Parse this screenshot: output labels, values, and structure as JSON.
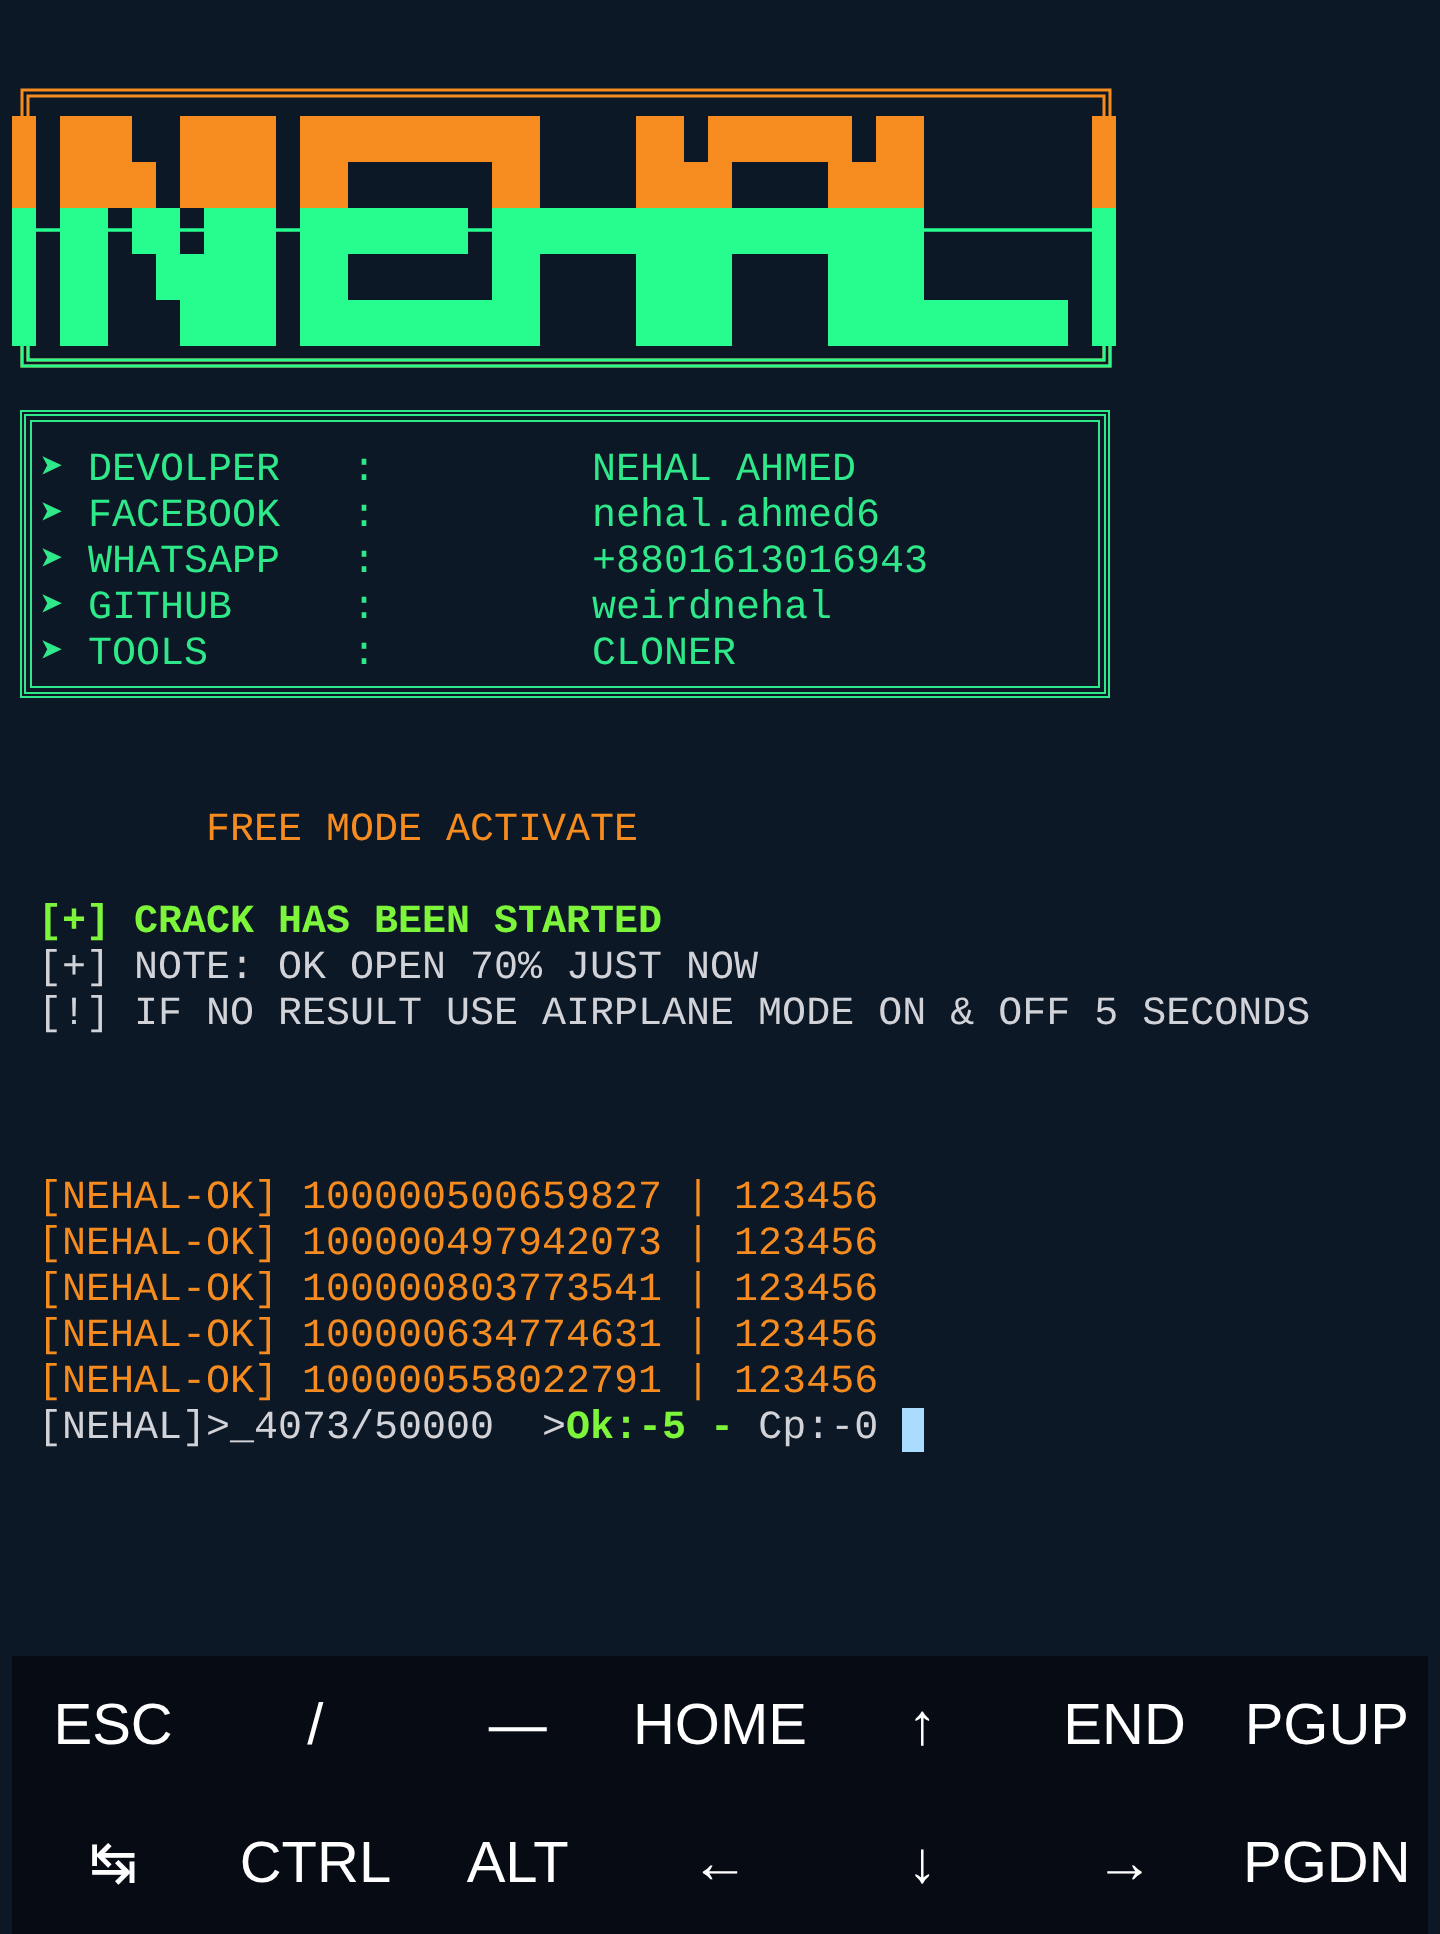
{
  "info": [
    {
      "bullet": "➤",
      "label": "DEVOLPER",
      "colon": ":",
      "value": "NEHAL AHMED"
    },
    {
      "bullet": "➤",
      "label": "FACEBOOK",
      "colon": ":",
      "value": "nehal.ahmed6"
    },
    {
      "bullet": "➤",
      "label": "WHATSAPP",
      "colon": ":",
      "value": "+8801613016943"
    },
    {
      "bullet": "➤",
      "label": "GITHUB",
      "colon": ":",
      "value": "weirdnehal"
    },
    {
      "bullet": "➤",
      "label": "TOOLS",
      "colon": ":",
      "value": "CLONER"
    }
  ],
  "mode": "FREE MODE ACTIVATE",
  "messages": [
    {
      "kind": "success",
      "text": "[+] CRACK HAS BEEN STARTED"
    },
    {
      "kind": "note",
      "text": "[+] NOTE: OK OPEN 70% JUST NOW"
    },
    {
      "kind": "note",
      "text": "[!] IF NO RESULT USE AIRPLANE MODE ON & OFF 5 SECONDS"
    }
  ],
  "results": [
    "[NEHAL-OK] 100000500659827 | 123456",
    "[NEHAL-OK] 100000497942073 | 123456",
    "[NEHAL-OK] 100000803773541 | 123456",
    "[NEHAL-OK] 100000634774631 | 123456",
    "[NEHAL-OK] 100000558022791 | 123456"
  ],
  "prompt": {
    "progress": "[NEHAL]>_4073/50000  >",
    "ok": "Ok:-5 -",
    "cp": "Cp:-0"
  },
  "keys": [
    [
      "ESC",
      "/",
      "—",
      "HOME",
      "↑",
      "END",
      "PGUP"
    ],
    [
      "↹",
      "CTRL",
      "ALT",
      "←",
      "↓",
      "→",
      "PGDN"
    ]
  ]
}
